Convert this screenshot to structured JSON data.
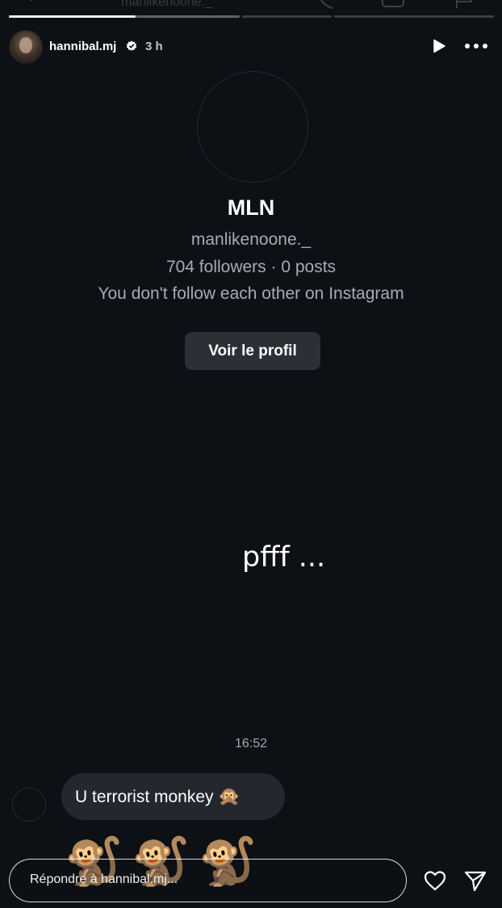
{
  "story": {
    "username": "hannibal.mj",
    "time": "3 h",
    "progress_fraction_segment1": 0.55
  },
  "background_header": {
    "title": "manlikenoone._"
  },
  "profile_card": {
    "name": "MLN",
    "handle": "manlikenoone._",
    "stats": "704 followers · 0 posts",
    "note": "You don't follow each other on Instagram",
    "button": "Voir le profil"
  },
  "caption": "pfff ...",
  "chat": {
    "timestamp": "16:52",
    "message": "U terrorist monkey",
    "message_emoji": "🙊"
  },
  "monkeys": [
    "🐒",
    "🐒",
    "🐒"
  ],
  "reply": {
    "placeholder": "Répondre à hannibal.mj..."
  },
  "icons": {
    "verified": "verified-badge-icon",
    "play": "play-icon",
    "more": "more-options-icon",
    "heart": "heart-icon",
    "send": "send-icon"
  },
  "colors": {
    "background": "#0d1014",
    "bubble": "#24282e",
    "button": "#2b3036",
    "secondary_text": "#a8acb2"
  }
}
